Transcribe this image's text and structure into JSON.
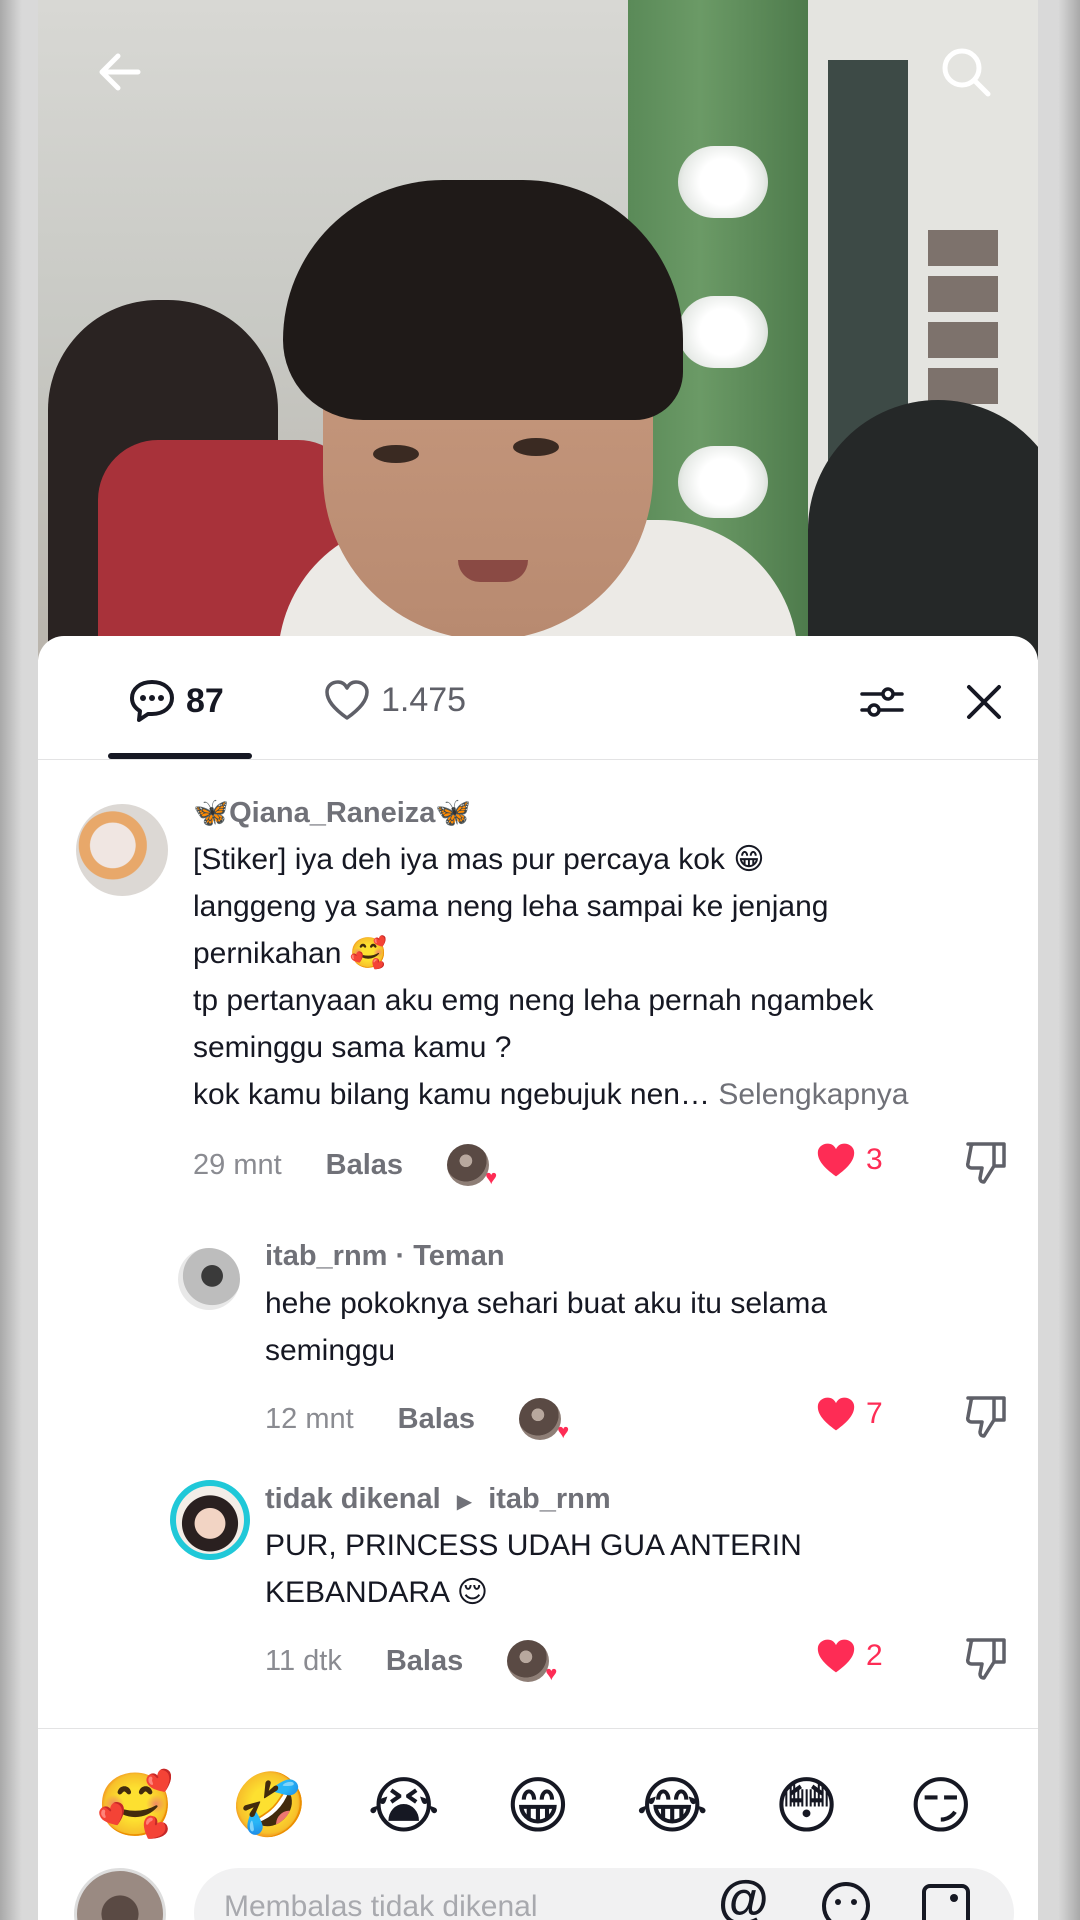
{
  "header": {
    "comments_count": "87",
    "likes_count": "1.475"
  },
  "comments": [
    {
      "username": "🦋Qiana_Raneiza🦋",
      "lines": [
        "[Stiker] iya deh iya mas pur percaya kok 😁",
        "langgeng ya sama neng leha sampai ke jenjang",
        "pernikahan 🥰",
        "tp pertanyaan aku emg neng leha pernah ngambek",
        "seminggu sama kamu ?",
        "kok kamu bilang kamu ngebujuk nen…"
      ],
      "more_label": "Selengkapnya",
      "time": "29 mnt",
      "reply_label": "Balas",
      "likes": "3"
    },
    {
      "username": "itab_rnm · Teman",
      "lines": [
        "hehe pokoknya sehari buat aku itu selama",
        "seminggu"
      ],
      "time": "12 mnt",
      "reply_label": "Balas",
      "likes": "7"
    },
    {
      "username": "tidak dikenal",
      "reply_to": "itab_rnm",
      "lines": [
        "PUR, PRINCESS UDAH GUA ANTERIN",
        "KEBANDARA 😌"
      ],
      "time": "11 dtk",
      "reply_label": "Balas",
      "likes": "2"
    }
  ],
  "emoji_bar": [
    "🥰",
    "🤣",
    "😭",
    "😁",
    "😂",
    "😳",
    "😏"
  ],
  "input": {
    "placeholder": "Membalas tidak dikenal"
  },
  "colors": {
    "accent": "#fe2c55",
    "text": "#161823",
    "muted": "#707178"
  },
  "icons": [
    "back-arrow-icon",
    "search-icon",
    "comment-bubble-icon",
    "heart-outline-icon",
    "filter-sliders-icon",
    "close-icon",
    "heart-filled-icon",
    "dislike-icon",
    "mention-icon",
    "emoji-icon",
    "image-icon"
  ]
}
